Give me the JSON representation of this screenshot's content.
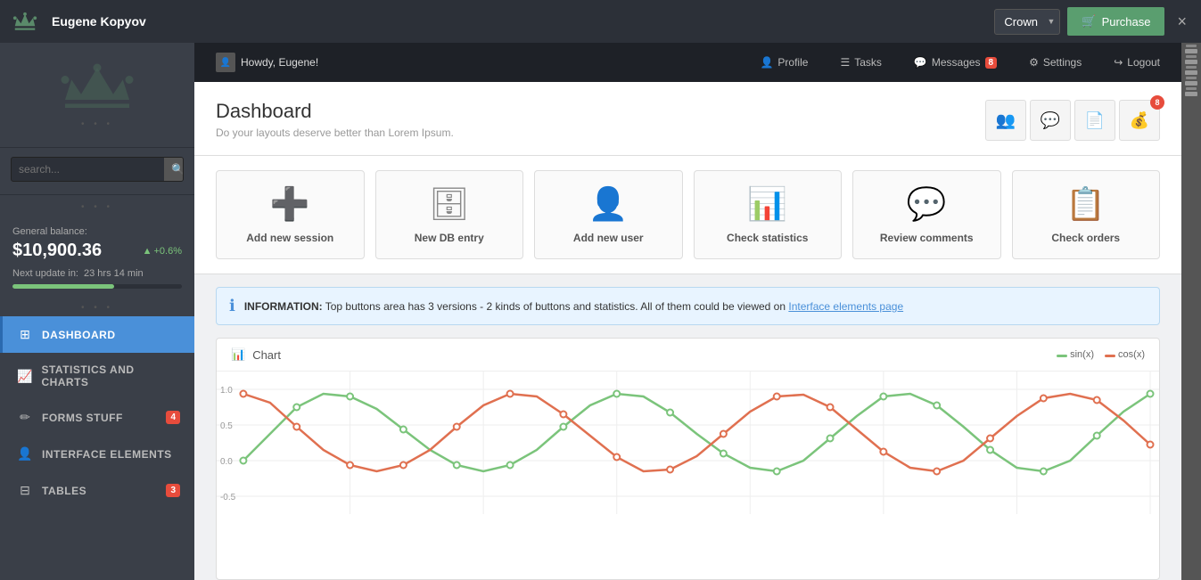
{
  "header": {
    "logo_alt": "Crown App Logo",
    "user_name": "Eugene Kopyov",
    "crown_label": "Crown",
    "purchase_label": "Purchase",
    "close_label": "×"
  },
  "topbar": {
    "greeting": "Howdy, Eugene!",
    "profile_label": "Profile",
    "tasks_label": "Tasks",
    "messages_label": "Messages",
    "messages_count": "8",
    "settings_label": "Settings",
    "logout_label": "Logout"
  },
  "dashboard": {
    "title": "Dashboard",
    "subtitle": "Do your layouts deserve better than Lorem Ipsum.",
    "icon_badge": "8"
  },
  "quick_actions": [
    {
      "icon": "➕",
      "label": "Add new session",
      "color": "#5ab55a"
    },
    {
      "icon": "🗄",
      "label": "New DB entry",
      "color": "#888"
    },
    {
      "icon": "👤",
      "label": "Add new user",
      "color": "#e07c3a"
    },
    {
      "icon": "📊",
      "label": "Check statistics",
      "color": "#4a90d9"
    },
    {
      "icon": "💬",
      "label": "Review comments",
      "color": "#4a90d9"
    },
    {
      "icon": "📋",
      "label": "Check orders",
      "color": "#b07830"
    }
  ],
  "info_bar": {
    "prefix": "INFORMATION:",
    "text": "Top buttons area has 3 versions - 2 kinds of buttons and statistics. All of them could be viewed on",
    "link_text": "Interface elements page"
  },
  "chart": {
    "title": "Chart",
    "legend": [
      {
        "label": "sin(x)",
        "color": "#7bc47b"
      },
      {
        "label": "cos(x)",
        "color": "#e07050"
      }
    ],
    "y_labels": [
      "1.0",
      "0.5",
      "0.0",
      "-0.5"
    ]
  },
  "sidebar": {
    "search_placeholder": "search...",
    "balance_label": "General balance:",
    "balance_amount": "$10,900.36",
    "balance_change": "+0.6%",
    "next_update_label": "Next update in:",
    "next_update_value": "23 hrs  14 min",
    "nav_items": [
      {
        "label": "Dashboard",
        "icon": "⊞",
        "active": true,
        "badge": null
      },
      {
        "label": "Statistics and Charts",
        "icon": "📈",
        "active": false,
        "badge": null
      },
      {
        "label": "Forms Stuff",
        "icon": "✏",
        "active": false,
        "badge": "4"
      },
      {
        "label": "Interface Elements",
        "icon": "👤",
        "active": false,
        "badge": null
      },
      {
        "label": "Tables",
        "icon": "⊟",
        "active": false,
        "badge": "3"
      }
    ]
  }
}
